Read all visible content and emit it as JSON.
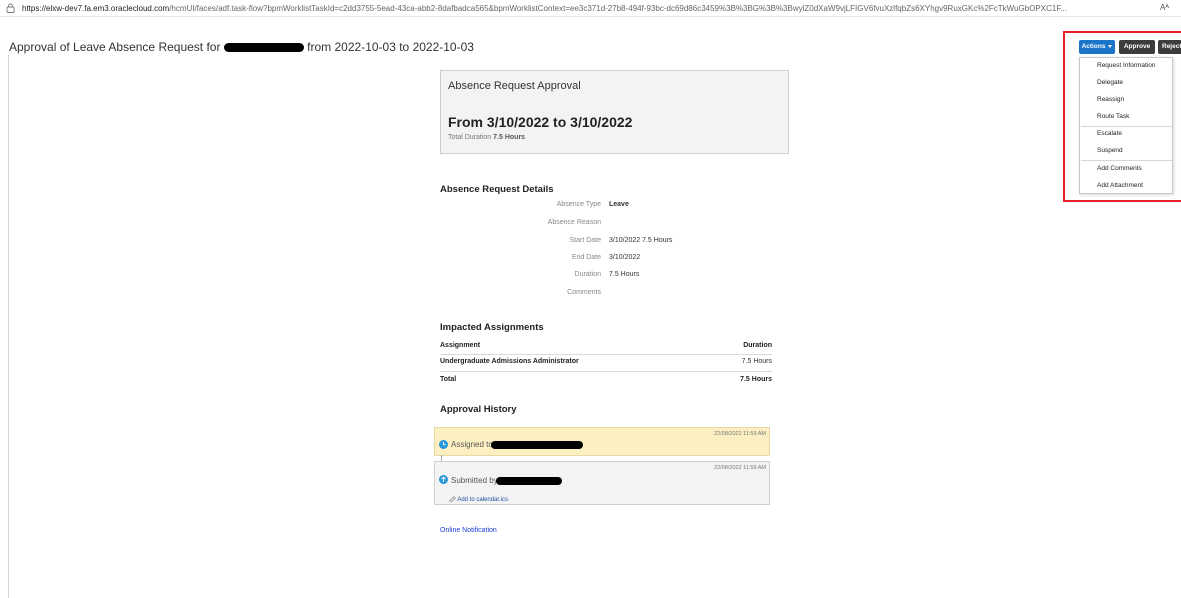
{
  "browser": {
    "url_host": "https://elxw-dev7.fa.em3.oraclecloud.com",
    "url_rest": "/hcmUI/faces/adf.task-flow?bpmWorklistTaskId=c2dd3755-5ead-43ca-abb2-8dafbadca565&bpmWorklistContext=ee3c371d-27b8-494f-93bc-dc69d86c3459%3B%3BG%3B%3BwylZ0dXaW9vjLFIGV6fvuXzlfqbZs6XYhgv9RuxGKc%2FcTkWuGbOPXC1F...",
    "reader_label": "Aᴬ"
  },
  "page": {
    "title_prefix": "Approval of Leave Absence Request for",
    "title_suffix": "from 2022-10-03 to 2022-10-03"
  },
  "toolbar": {
    "actions_label": "Actions",
    "approve_label": "Approve",
    "reject_label": "Reject"
  },
  "actions_menu": {
    "items": [
      "Request Information",
      "Delegate",
      "Reassign",
      "Route Task",
      "Escalate",
      "Suspend",
      "Add Comments",
      "Add Attachment"
    ]
  },
  "summary": {
    "heading": "Absence Request Approval",
    "dates": "From 3/10/2022 to 3/10/2022",
    "duration_label": "Total Duration",
    "duration_value": "7.5 Hours"
  },
  "details": {
    "heading": "Absence Request Details",
    "rows": [
      {
        "label": "Absence Type",
        "value": "Leave"
      },
      {
        "label": "Absence Reason",
        "value": ""
      },
      {
        "label": "Start Date",
        "value": "3/10/2022 7.5 Hours"
      },
      {
        "label": "End Date",
        "value": "3/10/2022"
      },
      {
        "label": "Duration",
        "value": "7.5 Hours"
      },
      {
        "label": "Comments",
        "value": ""
      }
    ]
  },
  "assignments": {
    "heading": "Impacted Assignments",
    "col_assignment": "Assignment",
    "col_duration": "Duration",
    "rows": [
      {
        "assignment": "Undergraduate Admissions Administrator",
        "duration": "7.5 Hours"
      }
    ],
    "total_label": "Total",
    "total_value": "7.5 Hours"
  },
  "history": {
    "heading": "Approval History",
    "entries": [
      {
        "date": "22/08/2022 11:59 AM",
        "text": "Assigned to"
      },
      {
        "date": "22/08/2022 11:59 AM",
        "text": "Submitted by",
        "link": "Add to calendar.ics"
      }
    ]
  },
  "footer": {
    "online_notification": "Online Notification"
  },
  "colors": {
    "accent": "#1a75c9",
    "highlight": "#e8202a",
    "pending_bg": "#fcf0c2"
  }
}
